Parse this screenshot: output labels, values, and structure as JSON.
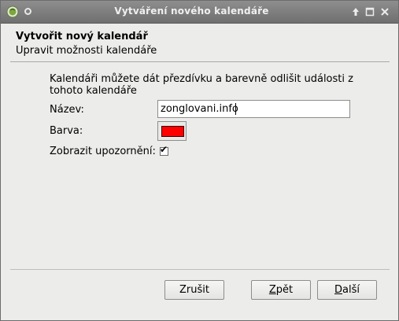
{
  "window": {
    "title": "Vytváření nového kalendáře"
  },
  "header": {
    "title": "Vytvořit nový kalendář",
    "subtitle": "Upravit možnosti kalendáře"
  },
  "form": {
    "intro": "Kalendáři můžete dát přezdívku a barevně odlišit události z tohoto kalendáře",
    "name_label": "Název:",
    "name_value": "zonglovani.info",
    "color_label": "Barva:",
    "color_value": "#ff0000",
    "alarm_label": "Zobrazit upozornění:",
    "alarm_checked": true
  },
  "buttons": {
    "cancel": "Zrušit",
    "back_mnemonic": "Z",
    "back_rest": "pět",
    "next_mnemonic": "D",
    "next_rest": "alší"
  },
  "icons": {
    "app": "calendar-app-icon",
    "sticky": "sticky-circle-icon",
    "up": "arrow-up-icon",
    "maximize": "maximize-icon",
    "close": "close-icon"
  }
}
